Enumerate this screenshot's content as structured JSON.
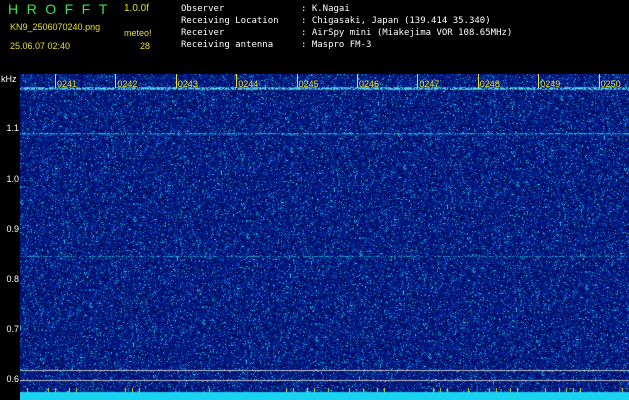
{
  "header": {
    "title": "HROFFT",
    "fps": "1.0.0f",
    "filename": "KN9_2506070240.png",
    "meteo_label": "meteo!",
    "timestamp": "25.06.07 02:40",
    "count": "28"
  },
  "info": [
    {
      "key": "Observer",
      "value": ": K.Nagai"
    },
    {
      "key": "Receiving Location",
      "value": ": Chigasaki, Japan (139.414 35.340)"
    },
    {
      "key": "Receiver",
      "value": ": AirSpy mini (Miakejima VOR 108.65MHz)"
    },
    {
      "key": "Receiving antenna",
      "value": ": Maspro FM-3"
    }
  ],
  "axis": {
    "unit": "kHz",
    "y_labels": [
      "1.1",
      "1.0",
      "0.9",
      "0.8",
      "0.7",
      "0.6"
    ],
    "time_labels": [
      "0241",
      "0242",
      "0243",
      "0244",
      "0245",
      "0246",
      "0247",
      "0248",
      "0249",
      "0250"
    ]
  },
  "colors": {
    "background": "#000000",
    "noise_dark": "#001a66",
    "noise_bright": "#23c8e8",
    "label_yellow": "#e8e020",
    "title_green": "#2ee84a",
    "baseline_cyan": "#19d3f0"
  }
}
